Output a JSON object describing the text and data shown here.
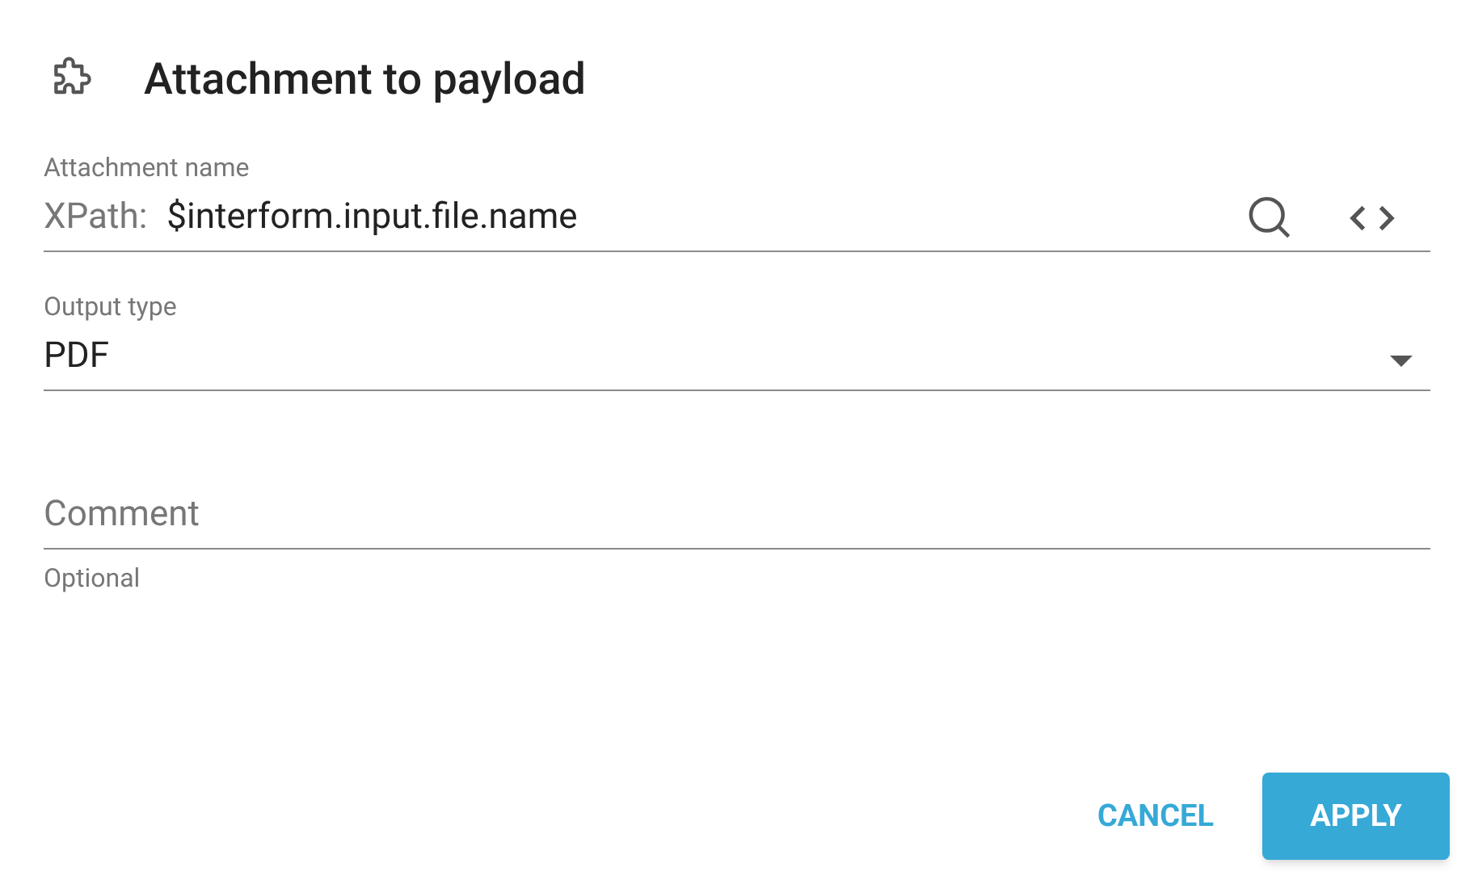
{
  "dialog": {
    "title": "Attachment to payload"
  },
  "fields": [
    {
      "kind": "xpath",
      "label": "Attachment name",
      "prefix": "XPath:",
      "value": "$interform.input.file.name"
    },
    {
      "kind": "select",
      "label": "Output type",
      "value": "PDF"
    },
    {
      "kind": "text",
      "placeholder": "Comment",
      "helper": "Optional"
    }
  ],
  "buttons": [
    {
      "label": "CANCEL",
      "kind": "flat"
    },
    {
      "label": "APPLY",
      "kind": "raised"
    }
  ]
}
